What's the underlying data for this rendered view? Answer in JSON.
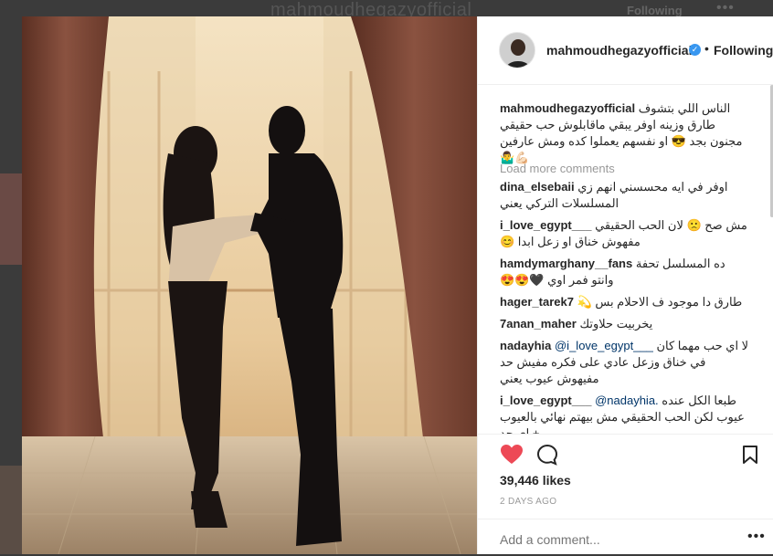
{
  "background": {
    "username": "mahmoudhegazyofficial",
    "following": "Following",
    "more": "•••"
  },
  "post": {
    "username": "mahmoudhegazyofficial",
    "separator": "•",
    "follow_state": "Following",
    "caption": "الناس اللي بتشوف طارق وزينه اوفر يبقي ماقابلوش حب حقيقي مجنون بجد 😎 او نفسهم يعملوا كده ومش عارفين 💪🏻🤷‍♂️",
    "load_more": "Load more comments",
    "comments": [
      {
        "user": "dina_elsebaii",
        "text": "اوفر في ايه محسسني انهم زي المسلسلات التركي يعني"
      },
      {
        "user": "i_love_egypt___",
        "text": "مش صح 🙁 لان الحب الحقيقي مفهوش خناق او زعل ابدا 😊"
      },
      {
        "user": "hamdymarghany__fans",
        "text": "ده المسلسل تحفة وانتو فمر اوي 🖤😍😍"
      },
      {
        "user": "hager_tarek7",
        "text": "طارق دا موجود ف الاحلام بس 💫"
      },
      {
        "user": "7anan_maher",
        "text": "يخربيت حلاوتك"
      },
      {
        "user": "nadayhia",
        "mention": "@i_love_egypt___",
        "text": "لا اي حب مهما كان في خناق وزعل عادي على فكره مفيش حد مفيهوش عيوب يعني"
      },
      {
        "user": "i_love_egypt___",
        "mention": "@nadayhia.",
        "text": "طبعا الكل عنده عيوب لكن الحب الحقيقي مش بيهتم نهائي بالعيوب + اي حد"
      }
    ],
    "likes": "39,446 likes",
    "time_ago": "2 DAYS AGO",
    "add_comment_placeholder": "Add a comment...",
    "more_options": "•••"
  },
  "colors": {
    "like_red": "#ed4956",
    "verified_blue": "#3897f0",
    "text": "#262626",
    "muted": "#999999"
  },
  "icons": [
    "heart-icon",
    "comment-icon",
    "bookmark-icon",
    "verified-badge-icon",
    "more-options-icon"
  ]
}
